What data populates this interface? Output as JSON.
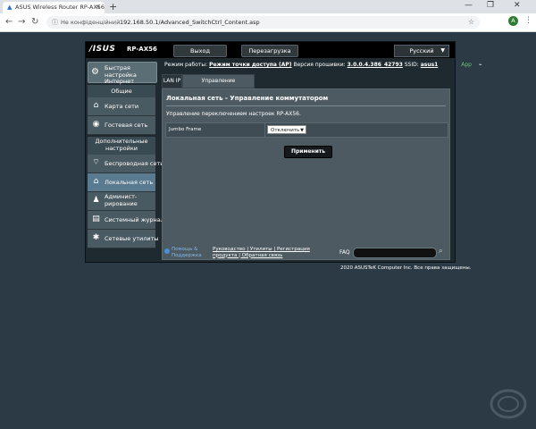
{
  "browser": {
    "tab_title": "ASUS Wireless Router RP-AX56",
    "tab_close": "×",
    "new_tab": "+",
    "win_minimize": "—",
    "win_restore": "❐",
    "win_close": "✕",
    "back": "←",
    "forward": "→",
    "reload": "↻",
    "security_text": "Не конфіденційний",
    "separator": "|",
    "url": "192.168.50.1/Advanced_SwitchCtrl_Content.asp",
    "star": "☆",
    "avatar_letter": "A",
    "menu": "⋮"
  },
  "router": {
    "logo": "/ISUS",
    "model": "RP-AX56",
    "logout": "Выход",
    "reboot": "Перезагрузка",
    "language": "Русский",
    "sidebar": {
      "qis_label": "Быстрая настройка Интернет",
      "general_header": "Общие",
      "general_items": [
        {
          "label": "Карта сети",
          "icon": "network-map-icon"
        },
        {
          "label": "Гостевая сеть",
          "icon": "guest-network-icon"
        }
      ],
      "advanced_header": "Дополнительные настройки",
      "advanced_items": [
        {
          "label": "Беспроводная сеть",
          "icon": "wireless-icon"
        },
        {
          "label": "Локальная сеть",
          "icon": "lan-icon",
          "active": true
        },
        {
          "label": "Админист-\nрирование",
          "icon": "administration-icon"
        },
        {
          "label": "Системный журнал",
          "icon": "system-log-icon"
        },
        {
          "label": "Сетевые утилиты",
          "icon": "network-tools-icon"
        }
      ]
    },
    "status": {
      "mode_label": "Режим работы:",
      "mode_value": "Режим точки доступа (AP)",
      "fw_label": "Версия прошивки:",
      "fw_value": "3.0.0.4.386_42793",
      "ssid_label": "SSID:",
      "ssid_value": "asus1",
      "app_label": "App"
    },
    "tabs": [
      "LAN IP",
      "Управление коммутатором"
    ],
    "content": {
      "title": "Локальная сеть - Управление коммутатором",
      "description": "Управление переключением настроек RP-AX56.",
      "jumbo_label": "Jumbo Frame",
      "jumbo_value": "Отключить",
      "apply": "Применить"
    },
    "footer": {
      "help": "Помощь &\nПоддержка",
      "links_line1": "Руководство | Утилиты | Регистрация",
      "links_line2": "продукта | Обратная связь",
      "faq": "FAQ"
    },
    "copyright": "2020 ASUSTeK Computer Inc. Все права защищены."
  },
  "colors": {
    "page_bg": "#2b3a44",
    "router_bg": "#1f2a30",
    "content_bg": "#4d5a61",
    "active_menu": "#5a7a90",
    "link_blue": "#8ab6e8",
    "app_green": "#5ad061"
  }
}
